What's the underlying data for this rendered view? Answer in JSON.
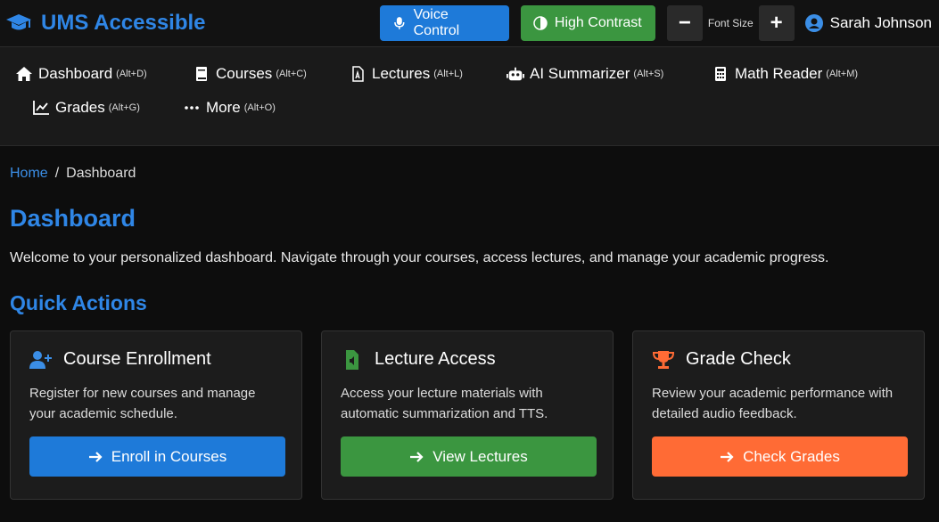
{
  "brand": {
    "title": "UMS Accessible",
    "color": "#2f86e6"
  },
  "top": {
    "voice_label": "Voice Control",
    "contrast_label": "High Contrast",
    "font_minus": "−",
    "font_label": "Font Size",
    "font_plus": "+",
    "user_name": "Sarah Johnson"
  },
  "nav": [
    {
      "label": "Dashboard",
      "key": "(Alt+D)",
      "icon": "home-icon"
    },
    {
      "label": "Courses",
      "key": "(Alt+C)",
      "icon": "book-icon"
    },
    {
      "label": "Lectures",
      "key": "(Alt+L)",
      "icon": "pdf-file-icon"
    },
    {
      "label": "AI Summarizer",
      "key": "(Alt+S)",
      "icon": "robot-icon"
    },
    {
      "label": "Math Reader",
      "key": "(Alt+M)",
      "icon": "calculator-icon"
    },
    {
      "label": "Grades",
      "key": "(Alt+G)",
      "icon": "line-chart-icon"
    },
    {
      "label": "More",
      "key": "(Alt+O)",
      "icon": "ellipsis-icon"
    }
  ],
  "breadcrumb": {
    "home": "Home",
    "sep": "/",
    "current": "Dashboard"
  },
  "page_title": "Dashboard",
  "welcome": "Welcome to your personalized dashboard. Navigate through your courses, access lectures, and manage your academic progress.",
  "section_title": "Quick Actions",
  "cards": [
    {
      "title": "Course Enrollment",
      "text": "Register for new courses and manage your academic schedule.",
      "button": "Enroll in Courses",
      "color": "#1e7ad9",
      "icon": "user-plus-icon"
    },
    {
      "title": "Lecture Access",
      "text": "Access your lecture materials with automatic summarization and TTS.",
      "button": "View Lectures",
      "color": "#3b9640",
      "icon": "audio-file-icon"
    },
    {
      "title": "Grade Check",
      "text": "Review your academic performance with detailed audio feedback.",
      "button": "Check Grades",
      "color": "#ff6b35",
      "icon": "trophy-icon"
    }
  ]
}
